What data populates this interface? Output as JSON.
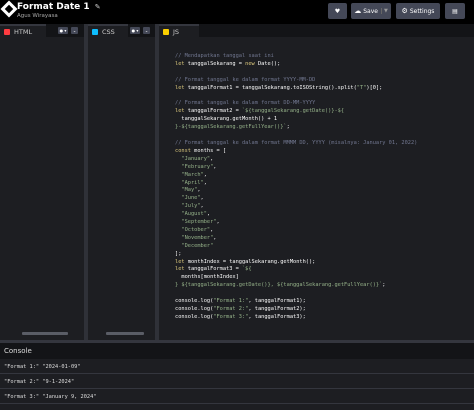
{
  "header": {
    "title": "Format Date 1",
    "author": "Agus Wirayasa",
    "save_label": "Save",
    "settings_label": "Settings"
  },
  "panes": {
    "html": {
      "label": "HTML"
    },
    "css": {
      "label": "CSS"
    },
    "js": {
      "label": "JS"
    }
  },
  "colors": {
    "html_badge": "#ff3c41",
    "css_badge": "#0ebeff",
    "js_badge": "#fcd000"
  },
  "js_code": [
    [
      "c",
      "// Mendapatkan tanggal saat ini"
    ],
    [
      "k",
      "let ",
      "v",
      "tanggalSekarang = ",
      "k",
      "new ",
      "v",
      "Date();"
    ],
    [
      "x",
      ""
    ],
    [
      "c",
      "// Format tanggal ke dalam format YYYY-MM-DD"
    ],
    [
      "k",
      "let ",
      "v",
      "tanggalFormat1 = tanggalSekarang.toISOString().split(",
      "s",
      "\"T\"",
      "v",
      ")[0];"
    ],
    [
      "x",
      ""
    ],
    [
      "c",
      "// Format tanggal ke dalam format DD-MM-YYYY"
    ],
    [
      "k",
      "let ",
      "v",
      "tanggalFormat2 = ",
      "s",
      "`${tanggalSekarang.getDate()}-${"
    ],
    [
      "v",
      "  tanggalSekarang.getMonth() + 1"
    ],
    [
      "s",
      "}-${tanggalSekarang.getFullYear()}`",
      "v",
      ";"
    ],
    [
      "x",
      ""
    ],
    [
      "c",
      "// Format tanggal ke dalam format MMMM DD, YYYY (misalnya: January 01, 2022)"
    ],
    [
      "k",
      "const ",
      "v",
      "months = ["
    ],
    [
      "s",
      "  \"January\"",
      "v",
      ","
    ],
    [
      "s",
      "  \"February\"",
      "v",
      ","
    ],
    [
      "s",
      "  \"March\"",
      "v",
      ","
    ],
    [
      "s",
      "  \"April\"",
      "v",
      ","
    ],
    [
      "s",
      "  \"May\"",
      "v",
      ","
    ],
    [
      "s",
      "  \"June\"",
      "v",
      ","
    ],
    [
      "s",
      "  \"July\"",
      "v",
      ","
    ],
    [
      "s",
      "  \"August\"",
      "v",
      ","
    ],
    [
      "s",
      "  \"September\"",
      "v",
      ","
    ],
    [
      "s",
      "  \"October\"",
      "v",
      ","
    ],
    [
      "s",
      "  \"November\"",
      "v",
      ","
    ],
    [
      "s",
      "  \"December\""
    ],
    [
      "v",
      "];"
    ],
    [
      "k",
      "let ",
      "v",
      "monthIndex = tanggalSekarang.getMonth();"
    ],
    [
      "k",
      "let ",
      "v",
      "tanggalFormat3 = ",
      "s",
      "`${"
    ],
    [
      "v",
      "  months[monthIndex]"
    ],
    [
      "s",
      "} ${tanggalSekarang.getDate()}, ${tanggalSekarang.getFullYear()}`",
      "v",
      ";"
    ],
    [
      "x",
      ""
    ],
    [
      "v",
      "console.log(",
      "s",
      "\"Format 1:\"",
      "v",
      ", tanggalFormat1);"
    ],
    [
      "v",
      "console.log(",
      "s",
      "\"Format 2:\"",
      "v",
      ", tanggalFormat2);"
    ],
    [
      "v",
      "console.log(",
      "s",
      "\"Format 3:\"",
      "v",
      ", tanggalFormat3);"
    ]
  ],
  "console": {
    "title": "Console",
    "lines": [
      "\"Format 1:\" \"2024-01-09\"",
      "\"Format 2:\" \"9-1-2024\"",
      "\"Format 3:\" \"January 9, 2024\""
    ]
  }
}
